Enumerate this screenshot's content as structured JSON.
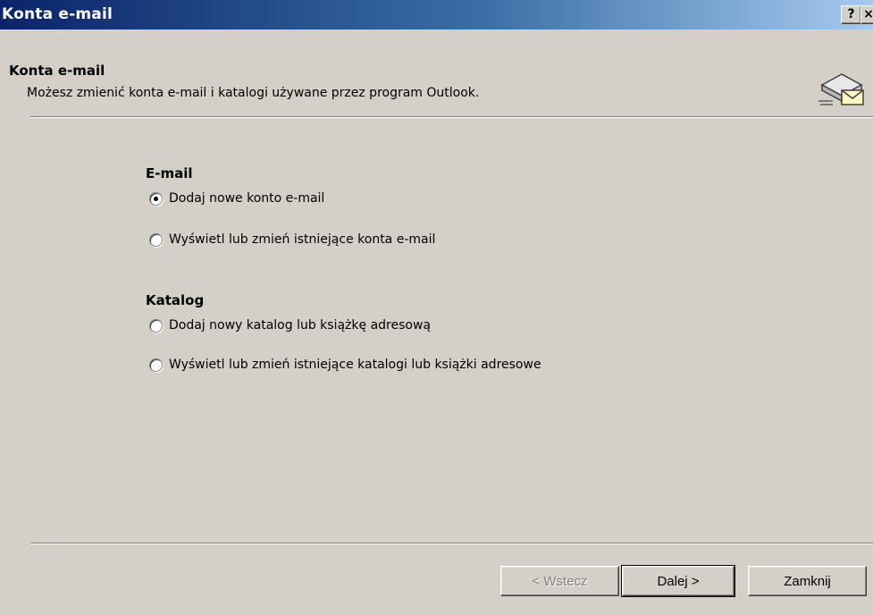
{
  "window": {
    "title": "Konta e-mail",
    "help_button": "?",
    "close_button": "×"
  },
  "header": {
    "title": "Konta e-mail",
    "description": "Możesz zmienić konta e-mail i katalogi używane przez program Outlook.",
    "icon": "mail-accounts-icon"
  },
  "email_group": {
    "title": "E-mail",
    "options": [
      {
        "label": "Dodaj nowe konto e-mail",
        "checked": true
      },
      {
        "label": "Wyświetl lub zmień istniejące konta e-mail",
        "checked": false
      }
    ]
  },
  "directory_group": {
    "title": "Katalog",
    "options": [
      {
        "label": "Dodaj nowy katalog lub książkę adresową",
        "checked": false
      },
      {
        "label": "Wyświetl lub zmień istniejące katalogi lub książki adresowe",
        "checked": false
      }
    ]
  },
  "buttons": {
    "back": "< Wstecz",
    "next": "Dalej >",
    "close": "Zamknij"
  },
  "colors": {
    "titlebar_start": "#0a246a",
    "titlebar_end": "#a6caf0",
    "dialog_bg": "#d4d0c8",
    "disabled_text": "#808080"
  }
}
